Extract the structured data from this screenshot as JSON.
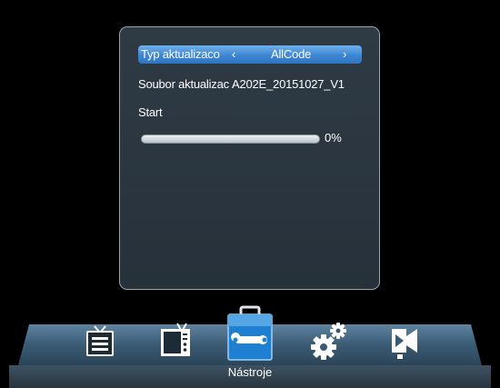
{
  "update_dialog": {
    "type_label": "Typ aktualizaco",
    "type_value": "AllCode",
    "arrow_left": "‹",
    "arrow_right": "›",
    "file_label": "Soubor aktualizac",
    "file_value": "A202E_20151027_V1",
    "start_label": "Start",
    "progress": 0,
    "progress_text": "0%"
  },
  "menu": {
    "selected_label": "Nástroje",
    "items": [
      {
        "icon": "tv-list-icon"
      },
      {
        "icon": "tv-info-icon"
      },
      {
        "icon": "toolbox-icon",
        "selected": true
      },
      {
        "icon": "gears-icon"
      },
      {
        "icon": "media-play-icon"
      }
    ]
  },
  "colors": {
    "highlight": "#3e86d2",
    "panel": "#2c3842",
    "menubar": "#3a5a72"
  }
}
